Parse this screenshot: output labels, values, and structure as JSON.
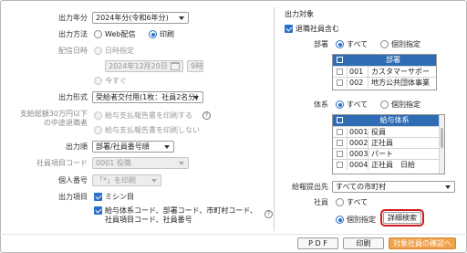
{
  "left": {
    "year": {
      "label": "出力年分",
      "value": "2024年分(令和6年分)"
    },
    "method": {
      "label": "出力方法",
      "options": [
        "Web配信",
        "印刷"
      ],
      "selected": "印刷"
    },
    "delivery": {
      "label": "配信日時",
      "options": [
        "日時指定",
        "今すぐ"
      ],
      "date": "2024年12月20日",
      "hour": "9時",
      "calendar_icon": "calendar-icon"
    },
    "format": {
      "label": "出力形式",
      "value": "受給者交付用(1枚：社員2名分)"
    },
    "under300k": {
      "label_line1": "支給総額30万円以下",
      "label_line2": "の中途退職者",
      "options": [
        "給与支払報告書を印刷する",
        "給与支払報告書を印刷しない"
      ]
    },
    "order": {
      "label": "出力順",
      "value": "部署/社員番号順"
    },
    "emp_item": {
      "label": "社員項目コード",
      "value": "0001 役職"
    },
    "personal_no": {
      "label": "個人番号",
      "value": "「*」を印刷"
    },
    "items": {
      "label": "出力項目",
      "item1": "ミシン目",
      "item2_line1": "給与体系コード、部署コード、市町村コード、",
      "item2_line2": "社員項目コード、社員番号"
    }
  },
  "right": {
    "title": "出力対象",
    "retired": "退職社員含む",
    "dept": {
      "label": "部署",
      "options": [
        "すべて",
        "個別指定"
      ],
      "header": "部署",
      "rows": [
        {
          "code": "001",
          "name": "カスタマーサポー"
        },
        {
          "code": "002",
          "name": "地方公共団体事業"
        }
      ]
    },
    "pay": {
      "label": "体系",
      "options": [
        "すべて",
        "個別指定"
      ],
      "header": "給与体系",
      "rows": [
        {
          "code": "0001",
          "name": "役員"
        },
        {
          "code": "0002",
          "name": "正社員"
        },
        {
          "code": "0003",
          "name": "パート"
        },
        {
          "code": "0004",
          "name": "正社員　日給"
        }
      ]
    },
    "dest": {
      "label": "給報提出先",
      "value": "すべての市町村"
    },
    "employee": {
      "label": "社員",
      "options": [
        "すべて",
        "個別指定"
      ],
      "detail_button": "詳細検索"
    }
  },
  "footer": {
    "pdf": "P D F",
    "print": "印刷",
    "confirm": "対象社員の確認へ"
  },
  "colors": {
    "accent": "#2a6fc9",
    "header_blue": "#2e6db4",
    "orange": "#f0a24a",
    "highlight": "#d21a1a"
  }
}
